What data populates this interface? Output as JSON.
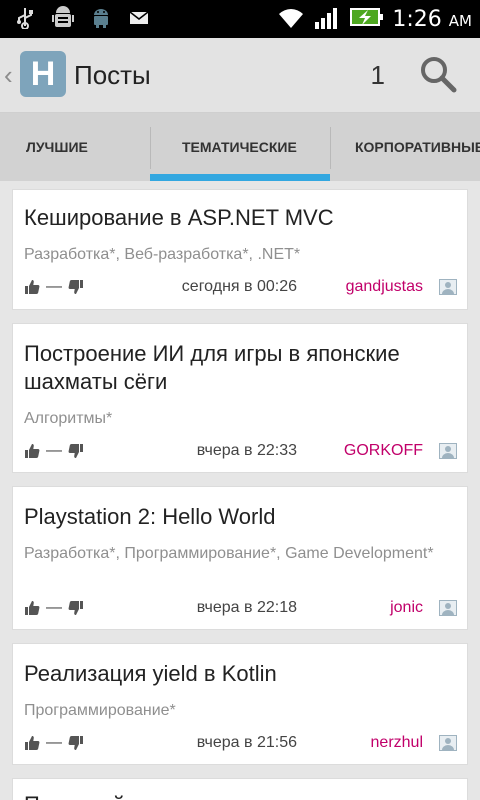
{
  "status_bar": {
    "time": "1:26",
    "ampm": "AM",
    "icons": [
      "usb-icon",
      "android-debug-icon",
      "android-icon",
      "email-icon",
      "wifi-icon",
      "signal-icon",
      "battery-charging-icon"
    ]
  },
  "action_bar": {
    "logo_letter": "H",
    "title": "Посты",
    "counter": "1"
  },
  "tabs": [
    {
      "label": "ЛУЧШИЕ"
    },
    {
      "label": "ТЕМАТИЧЕСКИЕ",
      "active": true
    },
    {
      "label": "КОРПОРАТИВНЫЕ"
    }
  ],
  "posts": [
    {
      "title": "Кеширование в ASP.NET MVC",
      "tags": "Разработка*, Веб-разработка*, .NET*",
      "rating": "—",
      "date": "сегодня в 00:26",
      "author": "gandjustas"
    },
    {
      "title": "Построение ИИ для игры в японские шахматы сёги",
      "tags": "Алгоритмы*",
      "rating": "—",
      "date": "вчера в 22:33",
      "author": "GORKOFF"
    },
    {
      "title": "Playstation 2: Hello World",
      "tags": "Разработка*, Программирование*, Game Development*",
      "rating": "—",
      "date": "вчера в 22:18",
      "author": "jonic"
    },
    {
      "title": "Реализация yield в Kotlin",
      "tags": "Программирование*",
      "rating": "—",
      "date": "вчера в 21:56",
      "author": "nerzhul"
    },
    {
      "title": "Почтовый сервис сегодня для ...",
      "tags": "",
      "rating": "",
      "date": "",
      "author": ""
    }
  ],
  "colors": {
    "accent": "#33a7e0",
    "author": "#c1006a",
    "logo": "#7ea4bb"
  }
}
